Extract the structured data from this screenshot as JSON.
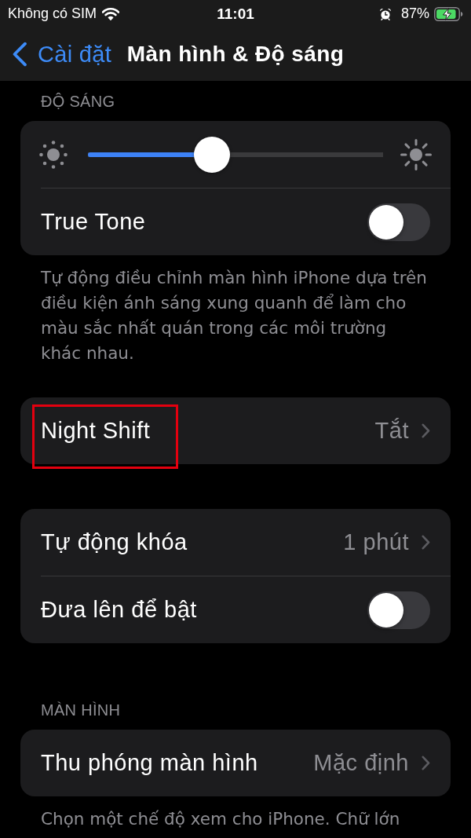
{
  "status_bar": {
    "carrier": "Không có SIM",
    "time": "11:01",
    "battery": "87%",
    "charging": true
  },
  "nav": {
    "back_label": "Cài đặt",
    "title": "Màn hình & Độ sáng"
  },
  "sections": [
    {
      "header": "ĐỘ SÁNG",
      "rows": [
        {
          "kind": "slider",
          "level": 0.42,
          "highlighted": false
        },
        {
          "kind": "toggle",
          "label": "True Tone",
          "on": false,
          "highlighted": false
        }
      ],
      "footer": "Tự động điều chỉnh màn hình iPhone dựa trên điều kiện ánh sáng xung quanh để làm cho màu sắc nhất quán trong các môi trường khác nhau."
    },
    {
      "rows": [
        {
          "kind": "link",
          "label": "Night Shift",
          "value": "Tắt",
          "highlighted": true
        }
      ]
    },
    {
      "rows": [
        {
          "kind": "link",
          "label": "Tự động khóa",
          "value": "1 phút",
          "highlighted": false
        },
        {
          "kind": "toggle",
          "label": "Đưa lên để bật",
          "on": false,
          "highlighted": false
        }
      ]
    },
    {
      "header": "MÀN HÌNH",
      "rows": [
        {
          "kind": "link",
          "label": "Thu phóng màn hình",
          "value": "Mặc định",
          "highlighted": false
        }
      ],
      "footer": "Chọn một chế độ xem cho iPhone. Chữ lớn"
    }
  ]
}
